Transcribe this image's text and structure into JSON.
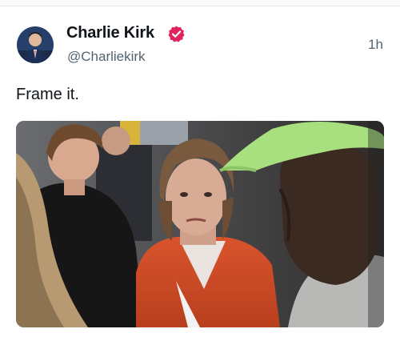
{
  "post": {
    "author_name": "Charlie Kirk",
    "handle": "@Charliekirk",
    "timestamp": "1h",
    "text": "Frame it.",
    "verified_color": "#e0245e"
  },
  "icons": {
    "avatar": "avatar-photo",
    "verified": "verified-badge-icon",
    "media": "photo-of-crowd"
  }
}
